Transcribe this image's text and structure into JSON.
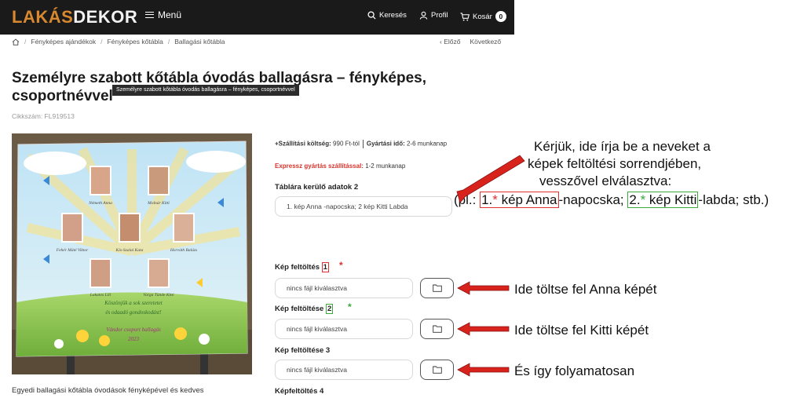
{
  "header": {
    "logo_part1": "LAKÁS",
    "logo_part2": "DEKOR",
    "menu_label": "Menü",
    "search_label": "Keresés",
    "profile_label": "Profil",
    "cart_label": "Kosár",
    "cart_count": "0"
  },
  "breadcrumb": {
    "items": [
      "Fényképes ajándékok",
      "Fényképes kőtábla",
      "Ballagási kőtábla"
    ],
    "prev": "Előző",
    "next": "Következő"
  },
  "product": {
    "title": "Személyre szabott kőtábla óvodás ballagásra – fényképes, csoportnévvel",
    "tooltip": "Személyre szabott kőtábla óvodás ballagásra – fényképes, csoportnévvel",
    "sku": "Cikkszám: FL919513",
    "description": "Egyedi ballagási kőtábla óvodások fényképével és kedves"
  },
  "photo_names": [
    "Németh Anna",
    "Molnár Kitti",
    "Fehér Máté Viktor",
    "Kis-Szalai Kata",
    "Horváth Balázs",
    "Lakatos Lili",
    "Varga Tünde Kitti"
  ],
  "photo_texts": [
    "Köszönjük a sok szeretetet",
    "és odaadó gondoskodást!",
    "Vándor csoport ballagás",
    "2023"
  ],
  "shipping": {
    "cost_label": "+Szállítási költség:",
    "cost_value": "990 Ft-tól",
    "time_label": "Gyártási idő:",
    "time_value": "2-6 munkanap",
    "express_label": "Expressz gyártás szállítással:",
    "express_value": "1-2 munkanap"
  },
  "form": {
    "data_label": "Táblára kerülő adatok 2",
    "data_value": "1. kép Anna -napocska; 2 kép Kitti Labda",
    "upload1_label": "Kép feltöltés",
    "upload1_num": "1",
    "upload2_label": "Kép feltöltése",
    "upload2_num": "2",
    "upload3_label": "Kép feltöltése 3",
    "upload4_label": "Képfeltöltés 4",
    "no_file": "nincs fájl kiválasztva",
    "star": "*"
  },
  "annotations": {
    "instr_line1": "Kérjük, ide írja be a neveket a",
    "instr_line2": "képek feltöltési sorrendjében,",
    "instr_line3": "vesszővel elválasztva:",
    "ex_open": "(pl.: ",
    "ex_1": "1.",
    "ex_2": " kép Anna",
    "ex_3": "-napocska; ",
    "ex_4": "2.",
    "ex_5": " kép Kitti",
    "ex_6": "-labda; stb.)",
    "upload_hint1": "Ide töltse fel Anna képét",
    "upload_hint2": "Ide töltse fel Kitti képét",
    "upload_hint3": "És így folyamatosan"
  }
}
